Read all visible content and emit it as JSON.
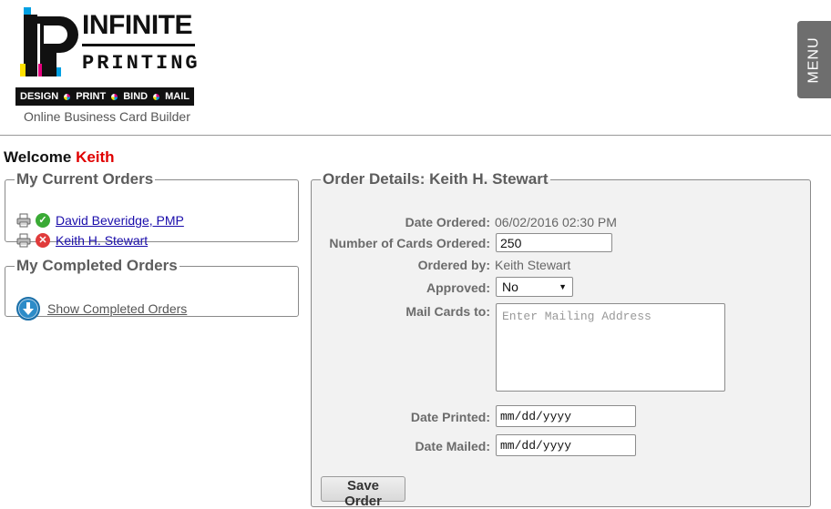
{
  "header": {
    "logo": {
      "mark_letters": "IP",
      "name_line1": "INFINITE",
      "name_line2": "PRINTING",
      "tagline_words": [
        "DESIGN",
        "PRINT",
        "BIND",
        "MAIL"
      ]
    },
    "subtitle": "Online Business Card Builder",
    "menu_label": "MENU"
  },
  "welcome": {
    "prefix": "Welcome",
    "user": "Keith"
  },
  "current_orders": {
    "legend": "My Current Orders",
    "items": [
      {
        "name": "David Beveridge, PMP",
        "status": "approved",
        "status_icon": "check-circle-icon"
      },
      {
        "name": "Keith H. Stewart",
        "status": "not-approved",
        "status_icon": "x-circle-icon"
      }
    ]
  },
  "completed_orders": {
    "legend": "My Completed Orders",
    "link": "Show Completed Orders"
  },
  "order_details": {
    "legend": "Order Details: Keith H. Stewart",
    "date_ordered_label": "Date Ordered:",
    "date_ordered_value": "06/02/2016 02:30 PM",
    "num_cards_label": "Number of Cards Ordered:",
    "num_cards_value": "250",
    "ordered_by_label": "Ordered by:",
    "ordered_by_value": "Keith Stewart",
    "approved_label": "Approved:",
    "approved_value": "No",
    "mail_to_label": "Mail Cards to:",
    "mail_to_placeholder": "Enter Mailing Address",
    "date_printed_label": "Date Printed:",
    "date_printed_placeholder": "mm/dd/yyyy",
    "date_mailed_label": "Date Mailed:",
    "date_mailed_placeholder": "mm/dd/yyyy",
    "save_label": "Save Order"
  },
  "colors": {
    "welcome_name": "#e00000",
    "approved": "#3aaa35",
    "rejected": "#e03b3b",
    "menu_bg": "#6e6e6e"
  }
}
